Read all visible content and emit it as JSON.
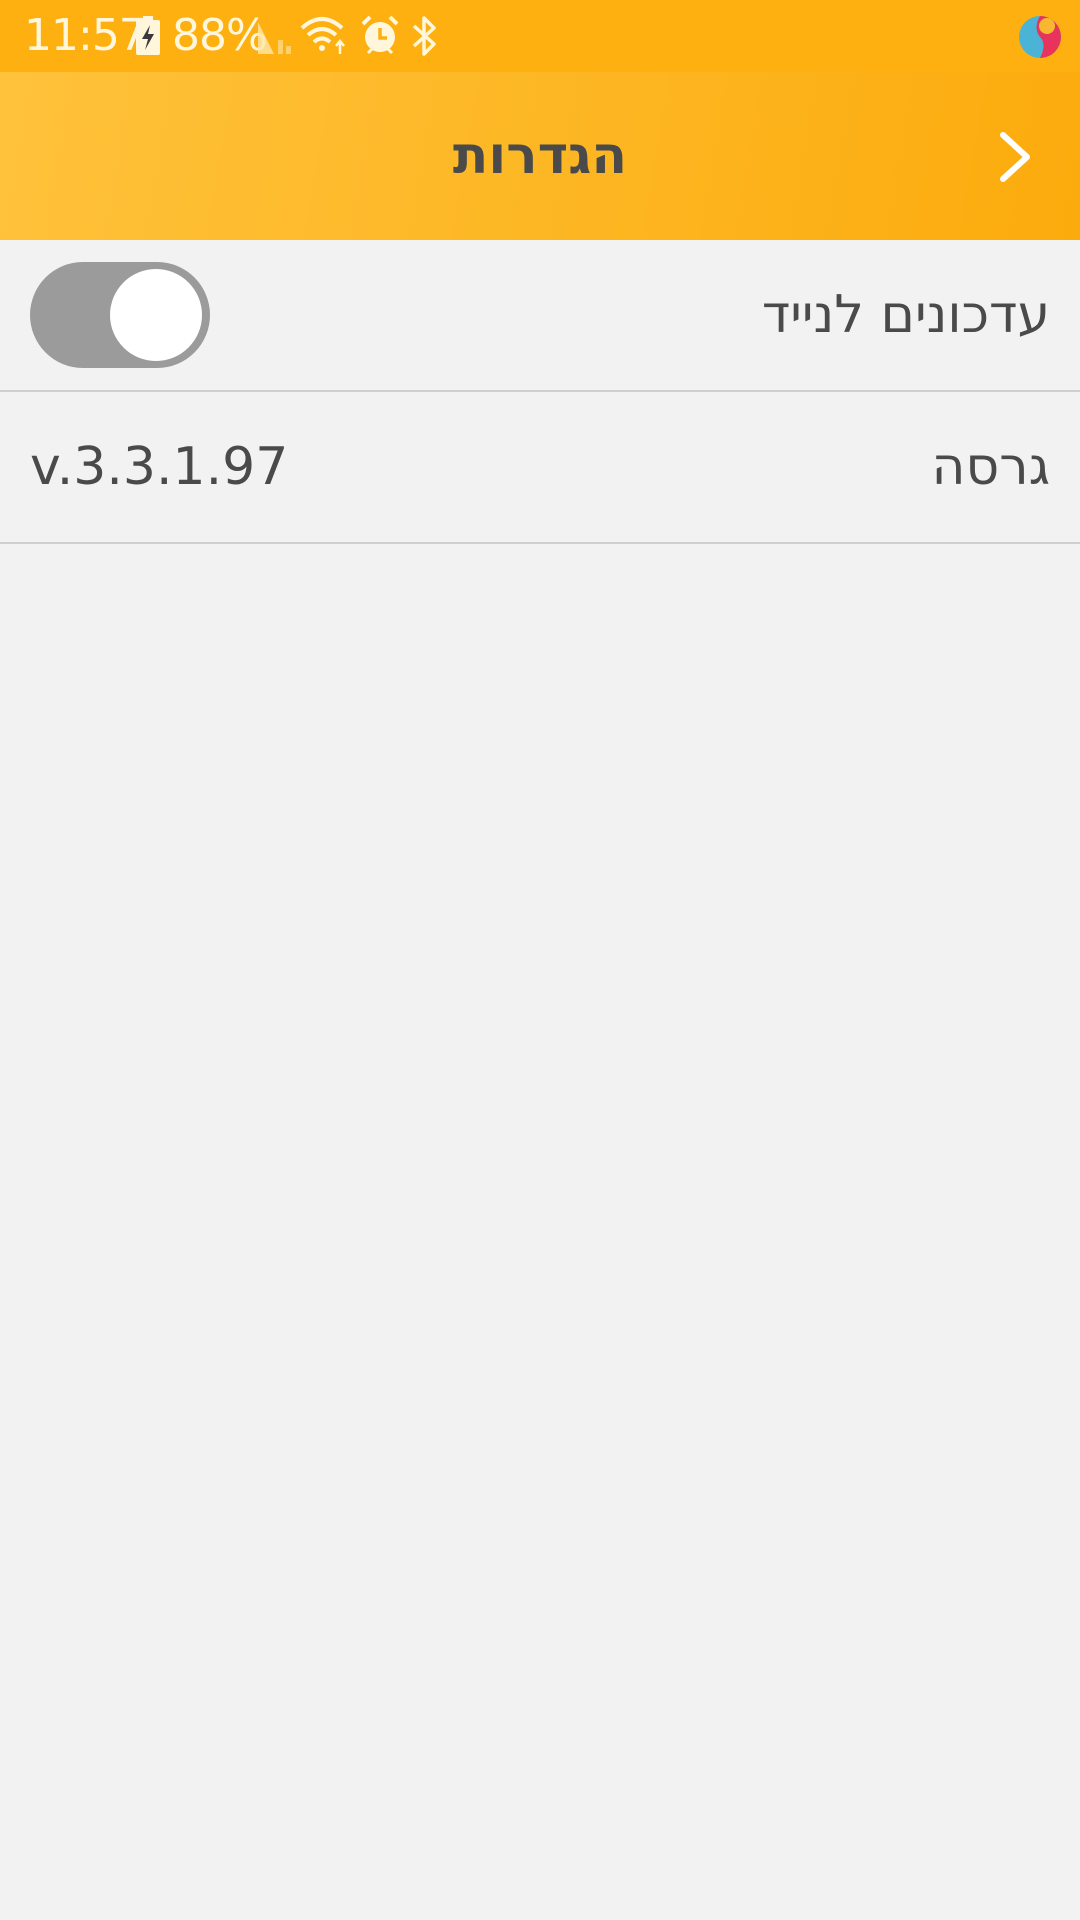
{
  "status_bar": {
    "time": "11:57",
    "battery_percent": "88%",
    "icons": [
      "battery-charging-icon",
      "signal-icon",
      "wifi-icon",
      "alarm-icon",
      "bluetooth-icon",
      "app-notification-icon"
    ],
    "background_color": "#fdb00f"
  },
  "app_bar": {
    "title": "הגדרות",
    "back_icon": "chevron-right-icon",
    "gradient_colors": [
      "#ffc23b",
      "#fcab0c"
    ]
  },
  "settings": {
    "mobile_updates": {
      "label": "עדכונים לנייד",
      "toggle_on": false
    },
    "version": {
      "label": "גרסה",
      "value": "v.3.3.1.97"
    }
  },
  "colors": {
    "page_background": "#f2f2f2",
    "text": "#4a4a4a",
    "toggle_track": "#9b9b9b",
    "divider": "#cfcfcf"
  }
}
